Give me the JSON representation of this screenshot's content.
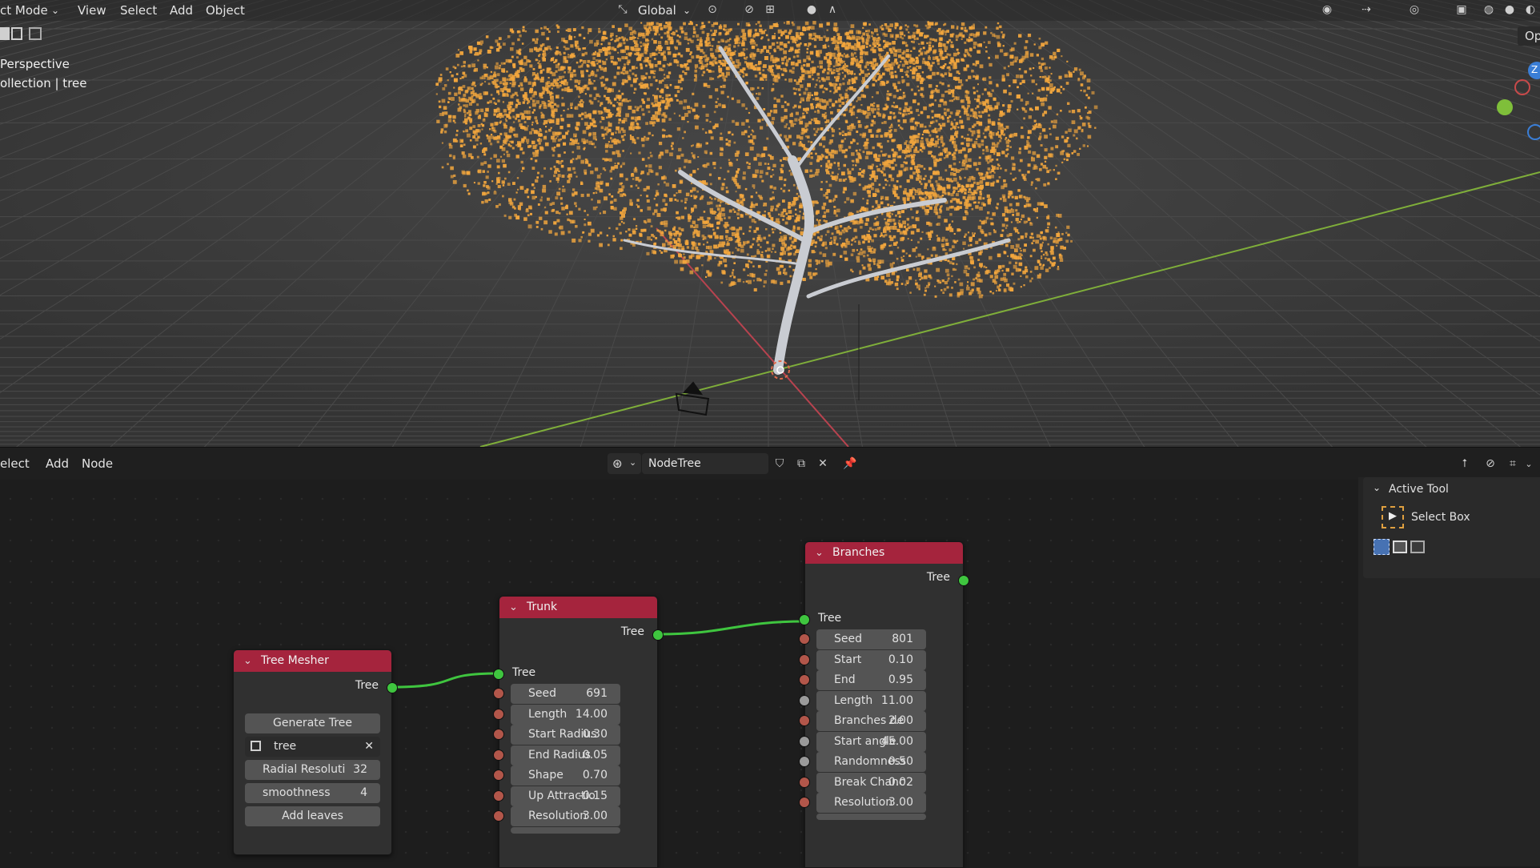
{
  "viewport": {
    "mode_label": "ct Mode",
    "menu": [
      "View",
      "Select",
      "Add",
      "Object"
    ],
    "transform_orientation": "Global",
    "overlay_line1": "Perspective",
    "overlay_line2": "ollection | tree",
    "options_label": "Op",
    "axis_z_label": "Z",
    "colors": {
      "foliage": "#f2a63d",
      "trunk": "#c9ccd2",
      "x_axis": "#b8434f",
      "y_axis": "#7fae3a"
    }
  },
  "node_editor": {
    "menu": [
      "elect",
      "Add",
      "Node"
    ],
    "tree_name": "NodeTree",
    "nodes": {
      "tree_mesher": {
        "title": "Tree Mesher",
        "output": "Tree",
        "generate_button": "Generate Tree",
        "object_field": "tree",
        "radial_resolution": {
          "label": "Radial Resoluti",
          "value": "32"
        },
        "smoothness": {
          "label": "smoothness",
          "value": "4"
        },
        "add_leaves_button": "Add leaves"
      },
      "trunk": {
        "title": "Trunk",
        "output": "Tree",
        "input": "Tree",
        "fields": [
          {
            "label": "Seed",
            "value": "691"
          },
          {
            "label": "Length",
            "value": "14.00"
          },
          {
            "label": "Start Radius",
            "value": "0.30"
          },
          {
            "label": "End Radius",
            "value": "0.05"
          },
          {
            "label": "Shape",
            "value": "0.70"
          },
          {
            "label": "Up Attractio",
            "value": "-0.15"
          },
          {
            "label": "Resolution",
            "value": "3.00"
          }
        ]
      },
      "branches": {
        "title": "Branches",
        "output": "Tree",
        "input": "Tree",
        "fields": [
          {
            "label": "Seed",
            "value": "801"
          },
          {
            "label": "Start",
            "value": "0.10"
          },
          {
            "label": "End",
            "value": "0.95"
          },
          {
            "label": "Length",
            "value": "11.00"
          },
          {
            "label": "Branches de",
            "value": "2.00"
          },
          {
            "label": "Start angle",
            "value": "45.00"
          },
          {
            "label": "Randomness",
            "value": "0.50"
          },
          {
            "label": "Break Chanc",
            "value": "0.02"
          },
          {
            "label": "Resolution",
            "value": "3.00"
          }
        ]
      }
    },
    "sidebar": {
      "section": "Active Tool",
      "tool": "Select Box"
    },
    "colors": {
      "node_header": "#a5243d",
      "socket_tree": "#3fc53f",
      "socket_float": "#b2564a",
      "wire": "#3fc53f"
    }
  }
}
